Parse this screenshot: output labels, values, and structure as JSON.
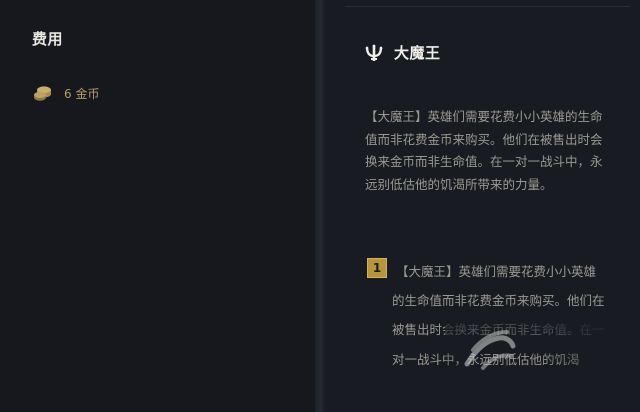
{
  "cost_panel": {
    "title": "费用",
    "cost_label": "6 金币",
    "coin_icon": "coin-stack-icon",
    "accent_color": "#b59c62"
  },
  "trait_panel": {
    "icon": "demon-trident-icon",
    "name": "大魔王",
    "description": "【大魔王】英雄们需要花费小小英雄的生命值而非花费金币来购买。他们在被售出时会换来金币而非生命值。在一对一战斗中，永远别低估他的饥渴所带来的力量。",
    "tiers": [
      {
        "level": "1",
        "text": "【大魔王】英雄们需要花费小小英雄的生命值而非花费金币来购买。他们在被售出时会换来金币而非生命值。在一对一战斗中，永远别低估他的饥渴"
      }
    ],
    "tier_color": "#b8953c"
  }
}
